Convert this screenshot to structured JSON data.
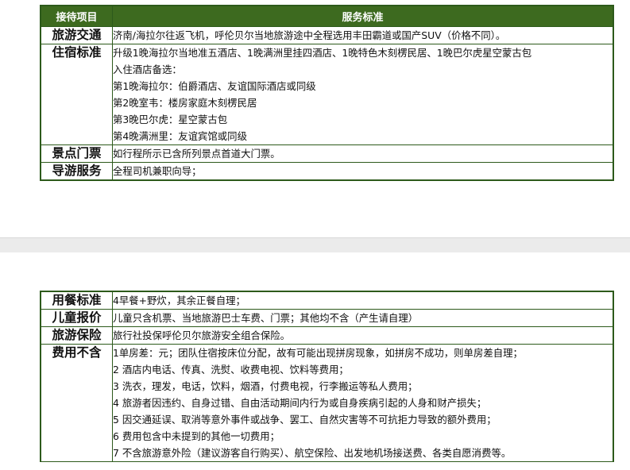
{
  "colors": {
    "header_bg": "#3d6a1f",
    "border": "#2d5a1b",
    "page_gap": "#ebebeb"
  },
  "table_top": {
    "header": {
      "item": "接待项目",
      "standard": "服务标准"
    },
    "rows": [
      {
        "item": "旅游交通",
        "lines": [
          "济南/海拉尔往返飞机，呼伦贝尔当地旅游途中全程选用丰田霸道或国产SUV（价格不同）。"
        ]
      },
      {
        "item": "住宿标准",
        "lines": [
          "升级1晚海拉尔当地准五酒店、1晚满洲里挂四酒店、1晚特色木刻楞民居、1晚巴尔虎星空蒙古包",
          "入住酒店备选：",
          "第1晚海拉尔：伯爵酒店、友谊国际酒店或同级",
          "第2晚室韦：楼房家庭木刻楞民居",
          "第3晚巴尔虎：星空蒙古包",
          "第4晚满洲里：友谊宾馆或同级"
        ]
      },
      {
        "item": "景点门票",
        "lines": [
          "如行程所示已含所列景点首道大门票。"
        ]
      },
      {
        "item": "导游服务",
        "lines": [
          "全程司机兼职向导；"
        ]
      }
    ]
  },
  "table_bottom": {
    "rows": [
      {
        "item": "用餐标准",
        "lines": [
          "4早餐+野炊，其余正餐自理；"
        ]
      },
      {
        "item": "儿童报价",
        "lines": [
          "儿童只含机票、当地旅游巴士车费、门票；其他均不含（产生请自理）"
        ]
      },
      {
        "item": "旅游保险",
        "lines": [
          "旅行社投保呼伦贝尔旅游安全组合保险。"
        ]
      },
      {
        "item": "费用不含",
        "lines": [
          "1单房差：元；团队住宿按床位分配，故有可能出现拼房现象，如拼房不成功，则单房差自理；",
          "2 酒店内电话、传真、洗熨、收费电视、饮料等费用；",
          "3 洗衣，理发，电话，饮料，烟酒，付费电视，行李搬运等私人费用；",
          "4 旅游者因违约、自身过错、自由活动期间内行为或自身疾病引起的人身和财产损失；",
          "5 因交通延误、取消等意外事件或战争、罢工、自然灾害等不可抗拒力导致的额外费用；",
          "6 费用包含中未提到的其他一切费用；",
          "7 不含旅游意外险（建议游客自行购买）、航空保险、出发地机场接送费、各类自愿消费等。"
        ]
      }
    ]
  }
}
